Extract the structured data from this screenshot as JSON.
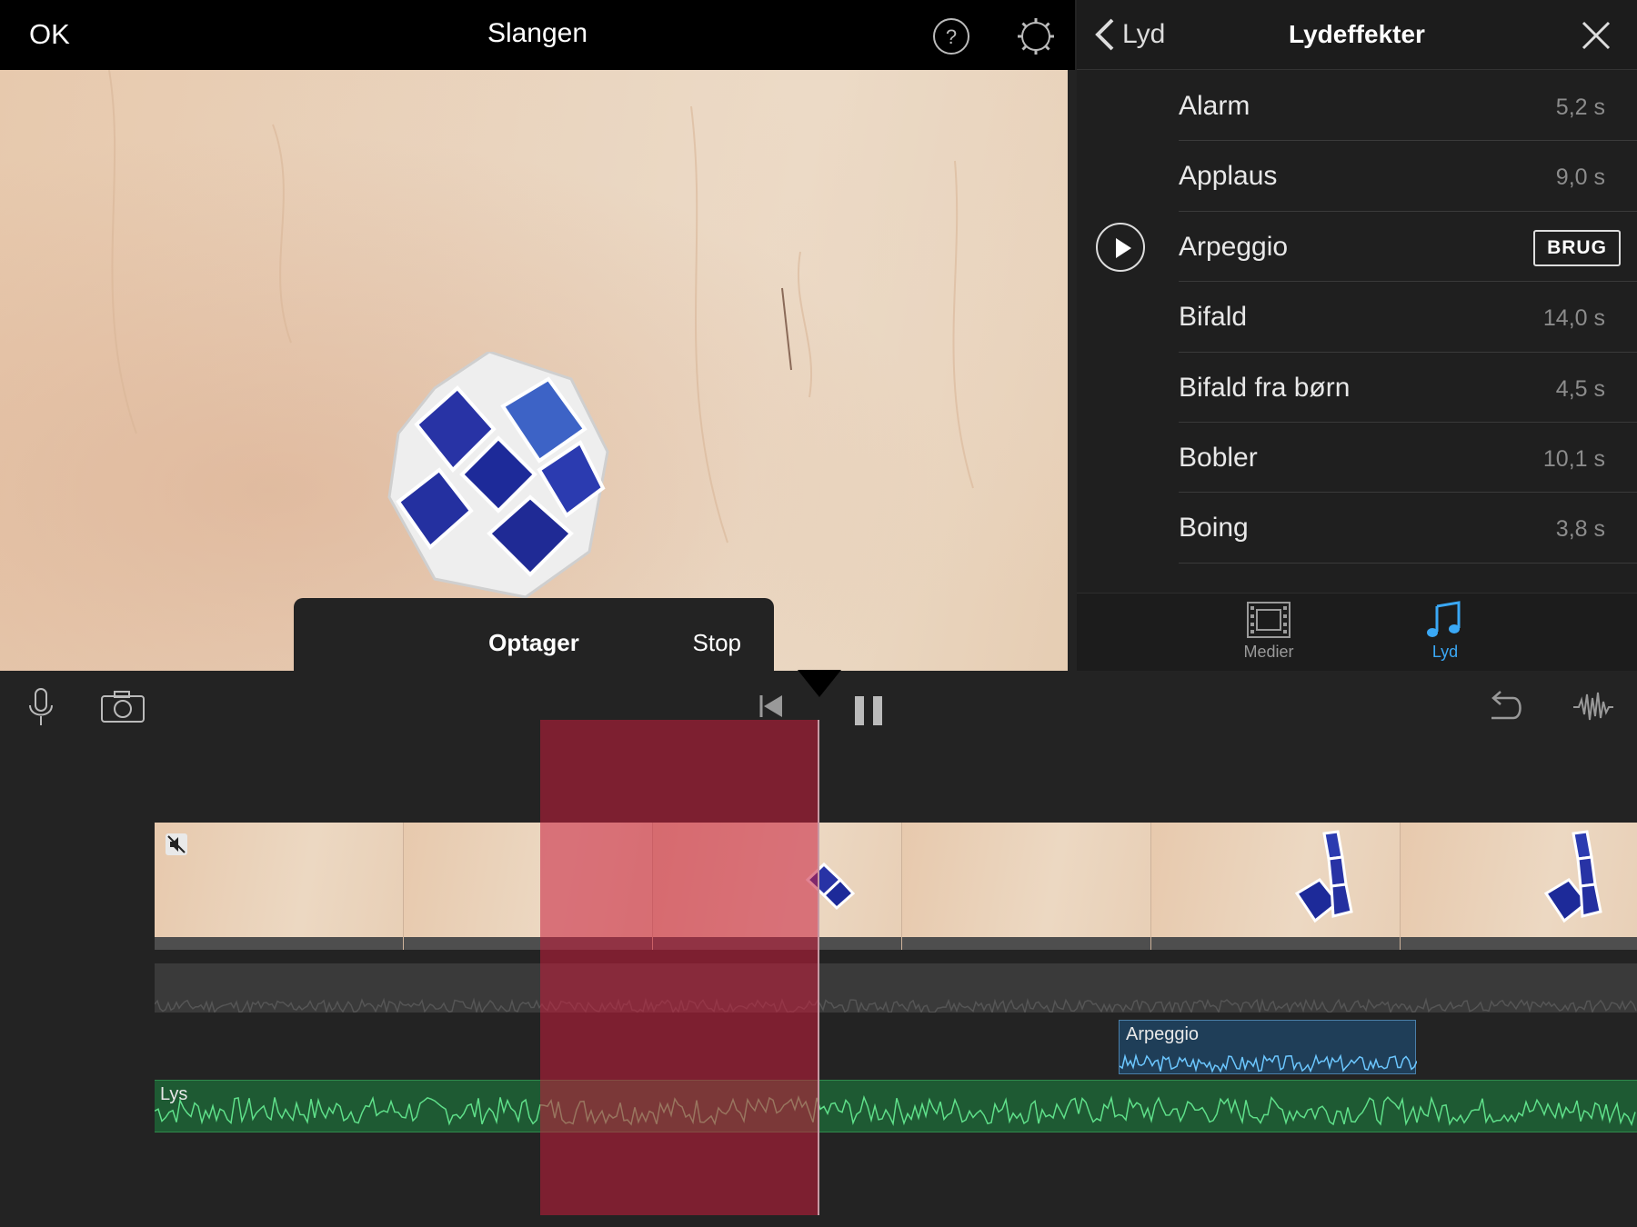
{
  "topbar": {
    "done_label": "OK",
    "project_title": "Slangen",
    "icons": [
      "help-icon",
      "gear-icon"
    ]
  },
  "recording": {
    "status": "Optager",
    "stop_label": "Stop",
    "meter_bars": [
      "#22ee22",
      "#22ee22",
      "#22ee22",
      "#1a4a1a",
      "#1a4a1a",
      "#1a4a1a",
      "#1a4a1a",
      "#1a4a1a",
      "#1a4a1a",
      "#1a4a1a",
      "#1a4a1a",
      "#1a4a1a",
      "#1a4a1a",
      "#1a4a1a",
      "#1a4a1a",
      "#1a4a1a",
      "#1a4a1a",
      "#1a4a1a",
      "#1a4a1a",
      "#1a4a1a",
      "#4a4a16",
      "#4a4a16",
      "#4a4a16",
      "#4a4a16",
      "#4a4a16",
      "#4a4a16",
      "#ffff33",
      "#4a4a16",
      "#4a4a16",
      "#4a4a16",
      "#4a1a1a",
      "#4a1a1a",
      "#4a1a1a",
      "#4a1a1a",
      "#4a1a1a"
    ]
  },
  "panel": {
    "back_label": "Lyd",
    "title": "Lydeffekter",
    "use_label": "BRUG",
    "effects": [
      {
        "name": "Alarm",
        "duration": "5,2 s"
      },
      {
        "name": "Applaus",
        "duration": "9,0 s"
      },
      {
        "name": "Arpeggio",
        "duration": ""
      },
      {
        "name": "Bifald",
        "duration": "14,0 s"
      },
      {
        "name": "Bifald fra børn",
        "duration": "4,5 s"
      },
      {
        "name": "Bobler",
        "duration": "10,1 s"
      },
      {
        "name": "Boing",
        "duration": "3,8 s"
      }
    ],
    "tabs": [
      {
        "label": "Medier",
        "icon": "film-icon"
      },
      {
        "label": "Lyd",
        "icon": "music-note-icon",
        "active": true
      }
    ],
    "accent": "#3aa8f5"
  },
  "timeline": {
    "sfx_clip_label": "Arpeggio",
    "music_label": "Lys",
    "recording_color": "#c81e3c",
    "music_color": "#1e5a33",
    "sfx_color": "#1f3e58"
  }
}
